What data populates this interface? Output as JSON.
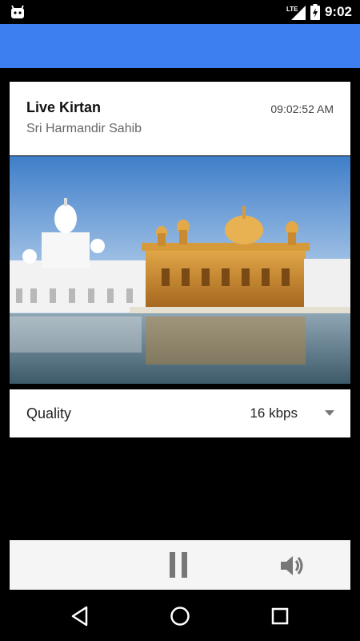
{
  "status_bar": {
    "network": "LTE",
    "time": "9:02",
    "icons": [
      "android-icon",
      "lte-signal-icon",
      "battery-icon"
    ]
  },
  "card": {
    "title": "Live Kirtan",
    "subtitle": "Sri Harmandir Sahib",
    "time": "09:02:52 AM"
  },
  "photo": {
    "alt": "Sri Harmandir Sahib"
  },
  "quality": {
    "label": "Quality",
    "value": "16 kbps"
  },
  "controls": {
    "icons": [
      "pause-icon",
      "volume-icon"
    ]
  },
  "navbar": {
    "icons": [
      "back-icon",
      "home-icon",
      "recents-icon"
    ]
  },
  "colors": {
    "app_bar": "#3d7fef",
    "background": "#000000",
    "card": "#ffffff",
    "controls_bg": "#f5f5f5"
  }
}
